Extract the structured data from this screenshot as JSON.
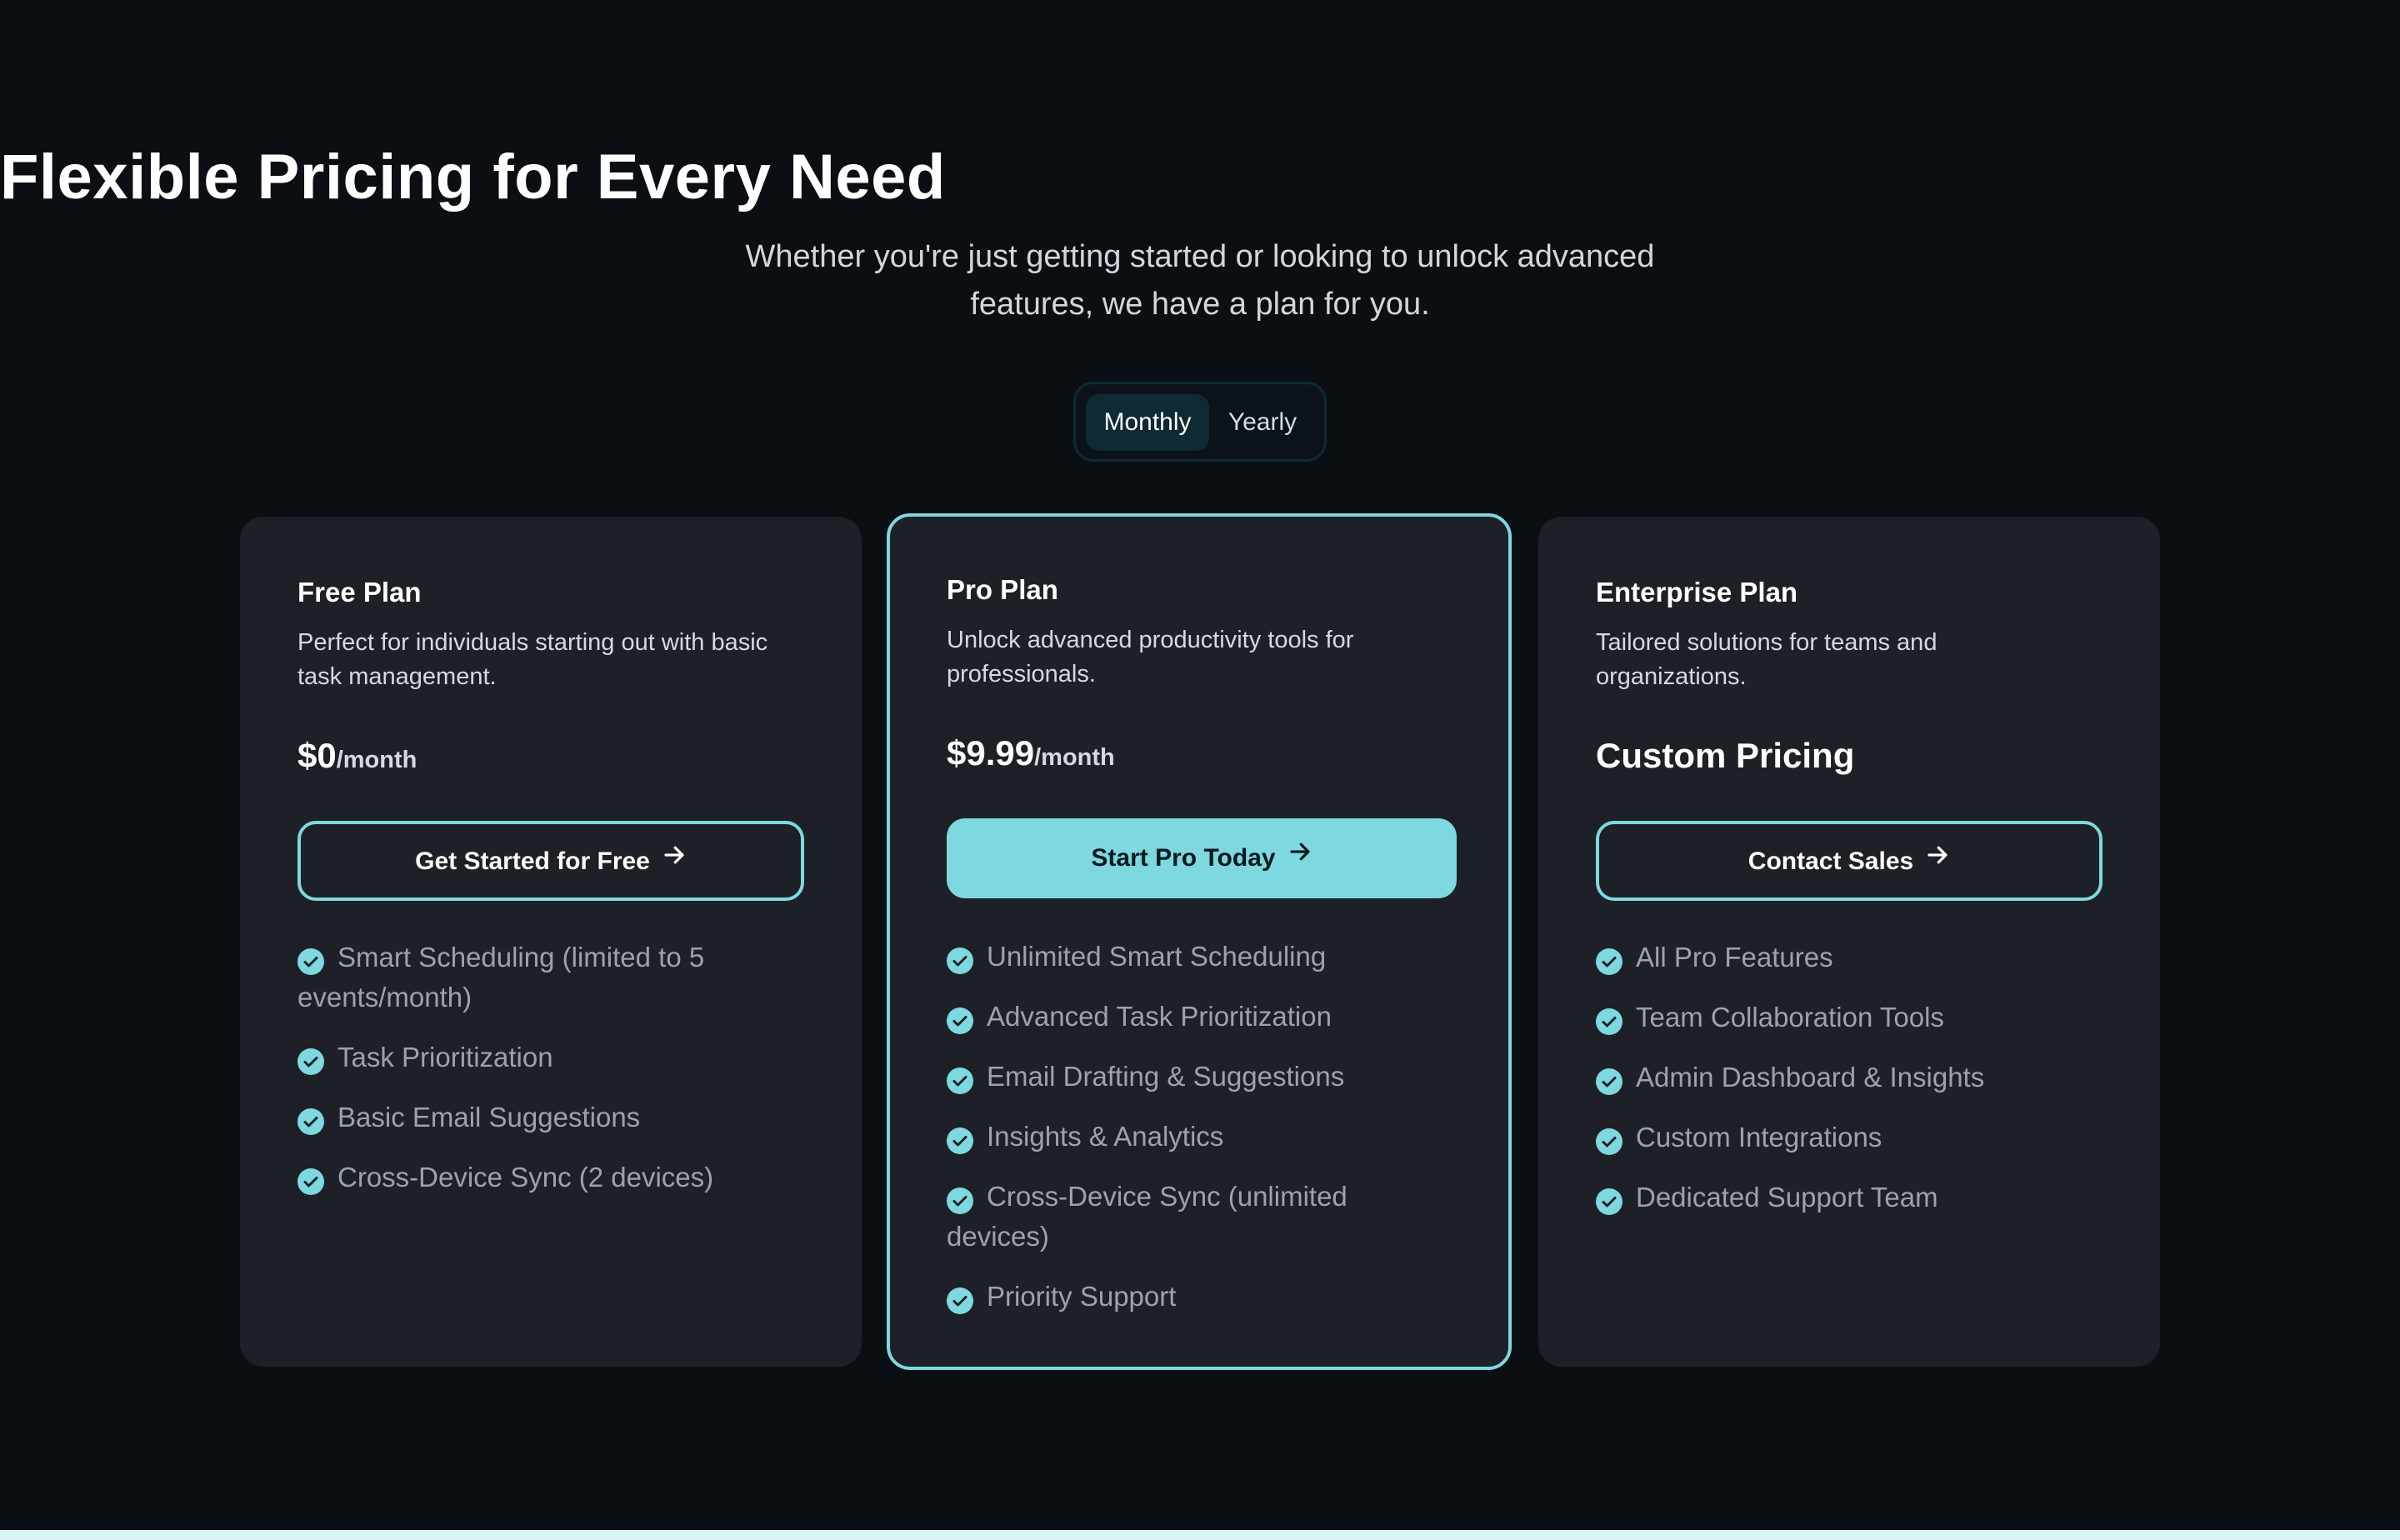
{
  "header": {
    "title": "Flexible Pricing for Every Need",
    "subtitle": "Whether you're just getting started or looking to unlock advanced features, we have a plan for you."
  },
  "billing_toggle": {
    "options": [
      "Monthly",
      "Yearly"
    ],
    "selected": "Monthly"
  },
  "colors": {
    "accent": "#7dd8df",
    "background": "#0b0e13",
    "card": "#1d2026"
  },
  "plans": [
    {
      "name": "Free Plan",
      "description": "Perfect for individuals starting out with basic task management.",
      "price": "$0",
      "period": "/month",
      "cta": "Get Started for Free",
      "features": [
        "Smart Scheduling (limited to 5 events/month)",
        "Task Prioritization",
        "Basic Email Suggestions",
        "Cross-Device Sync (2 devices)"
      ]
    },
    {
      "name": "Pro Plan",
      "description": "Unlock advanced productivity tools for professionals.",
      "price": "$9.99",
      "period": "/month",
      "cta": "Start Pro Today",
      "features": [
        "Unlimited Smart Scheduling",
        "Advanced Task Prioritization",
        "Email Drafting & Suggestions",
        "Insights & Analytics",
        "Cross-Device Sync (unlimited devices)",
        "Priority Support"
      ]
    },
    {
      "name": "Enterprise Plan",
      "description": "Tailored solutions for teams and organizations.",
      "price": "Custom Pricing",
      "cta": "Contact Sales",
      "features": [
        "All Pro Features",
        "Team Collaboration Tools",
        "Admin Dashboard & Insights",
        "Custom Integrations",
        "Dedicated Support Team"
      ]
    }
  ]
}
